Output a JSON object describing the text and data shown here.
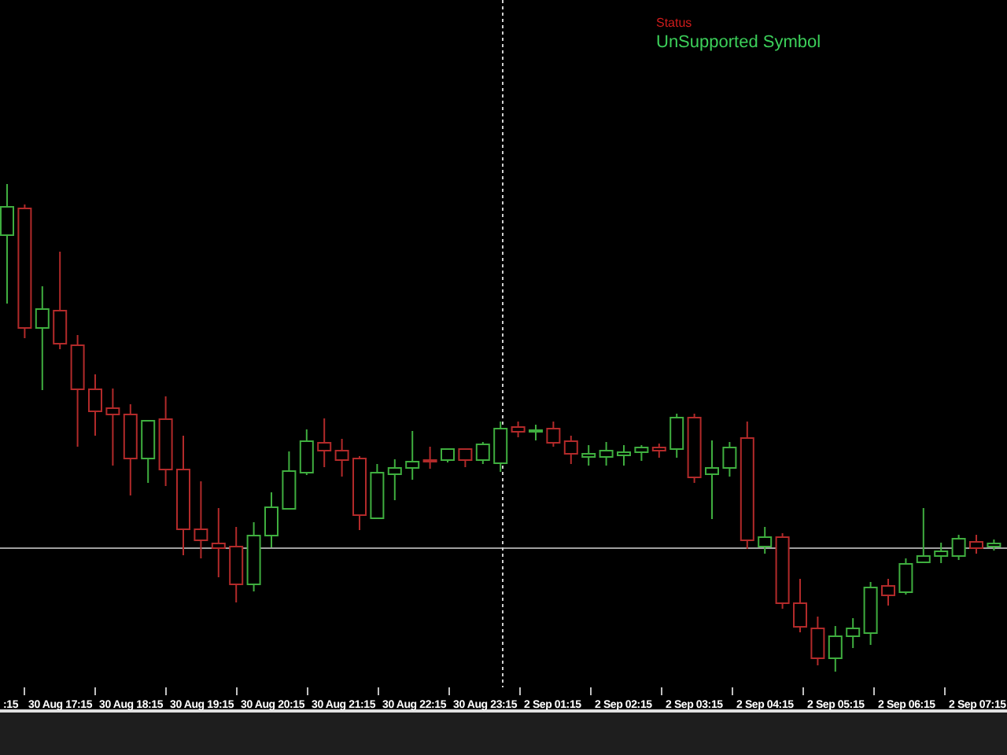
{
  "indicator": {
    "status_label": "Status",
    "message": "UnSupported Symbol"
  },
  "time_axis": {
    "labels": [
      ":15",
      "30 Aug 17:15",
      "30 Aug 18:15",
      "30 Aug 19:15",
      "30 Aug 20:15",
      "30 Aug 21:15",
      "30 Aug 22:15",
      "30 Aug 23:15",
      "2 Sep 01:15",
      "2 Sep 02:15",
      "2 Sep 03:15",
      "2 Sep 04:15",
      "2 Sep 05:15",
      "2 Sep 06:15",
      "2 Sep 07:15"
    ]
  }
}
